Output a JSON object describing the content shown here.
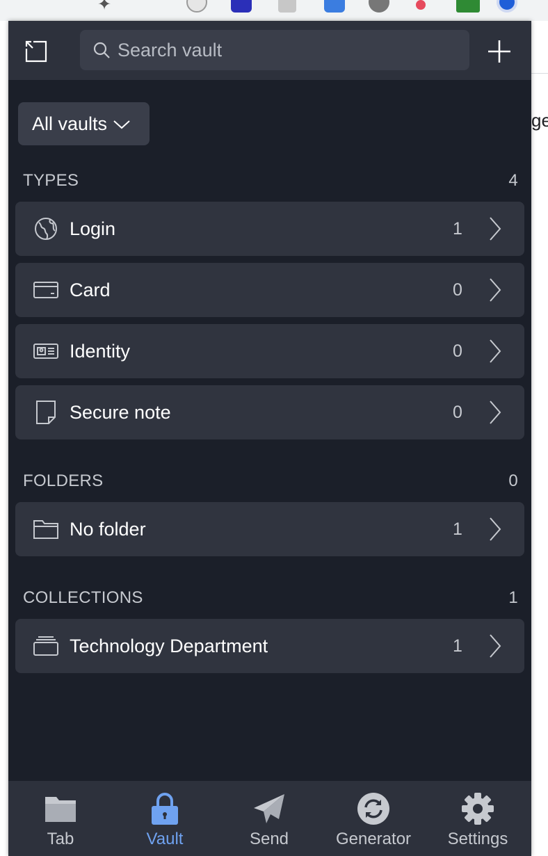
{
  "colors": {
    "popup_bg": "#1b1f29",
    "header_bg": "#2d313c",
    "row_bg": "#30343f",
    "accent": "#6fa2f0",
    "text": "#ffffff",
    "muted": "#c6c9cf"
  },
  "page_behind": {
    "text_fragment": "ge"
  },
  "header": {
    "popout_icon": "popout-icon",
    "search_placeholder": "Search vault",
    "search_value": "",
    "add_icon": "plus-icon"
  },
  "vault_filter": {
    "label": "All vaults",
    "icon": "chevron-down-icon"
  },
  "types": {
    "heading": "TYPES",
    "count": "4",
    "items": [
      {
        "label": "Login",
        "count": "1",
        "icon": "globe-icon"
      },
      {
        "label": "Card",
        "count": "0",
        "icon": "credit-card-icon"
      },
      {
        "label": "Identity",
        "count": "0",
        "icon": "id-card-icon"
      },
      {
        "label": "Secure note",
        "count": "0",
        "icon": "sticky-note-icon"
      }
    ]
  },
  "folders": {
    "heading": "FOLDERS",
    "count": "0",
    "items": [
      {
        "label": "No folder",
        "count": "1",
        "icon": "folder-icon"
      }
    ]
  },
  "collections": {
    "heading": "COLLECTIONS",
    "count": "1",
    "items": [
      {
        "label": "Technology Department",
        "count": "1",
        "icon": "collection-icon"
      }
    ]
  },
  "tabs": [
    {
      "label": "Tab",
      "icon": "folder-icon",
      "active": false
    },
    {
      "label": "Vault",
      "icon": "lock-icon",
      "active": true
    },
    {
      "label": "Send",
      "icon": "paper-plane-icon",
      "active": false
    },
    {
      "label": "Generator",
      "icon": "refresh-icon",
      "active": false
    },
    {
      "label": "Settings",
      "icon": "gear-icon",
      "active": false
    }
  ]
}
